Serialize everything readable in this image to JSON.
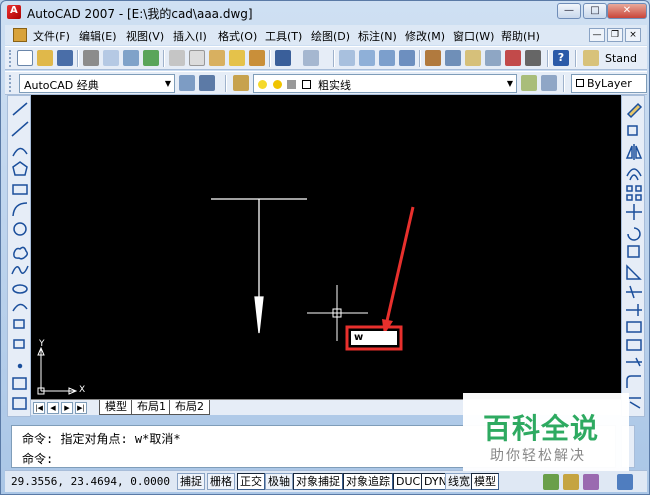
{
  "window": {
    "title": "AutoCAD 2007 - [E:\\我的cad\\aaa.dwg]",
    "minimize": "—",
    "maximize": "□",
    "close": "✕"
  },
  "menu": {
    "items": [
      "文件(F)",
      "编辑(E)",
      "视图(V)",
      "插入(I)",
      "格式(O)",
      "工具(T)",
      "绘图(D)",
      "标注(N)",
      "修改(M)",
      "窗口(W)",
      "帮助(H)"
    ],
    "mdi_min": "—",
    "mdi_restore": "❐",
    "mdi_close": "×"
  },
  "toolbar": {
    "text_style": "Stand"
  },
  "workspace": {
    "selected": "AutoCAD 经典"
  },
  "layer": {
    "current": "粗实线",
    "linetype": "ByLayer"
  },
  "canvas": {
    "cmd_popup_text": "w",
    "ucs_x": "X",
    "ucs_y": "Y",
    "annotation_color": "#e8302d"
  },
  "layout_tabs": [
    "模型",
    "布局1",
    "布局2"
  ],
  "command": {
    "history": "命令: 指定对角点: w*取消*",
    "prompt": "命令:"
  },
  "status": {
    "coordinates": "29.3556, 23.4694, 0.0000",
    "toggles": [
      "捕捉",
      "栅格",
      "正交",
      "极轴",
      "对象捕捉",
      "对象追踪",
      "DUCS",
      "DYN",
      "线宽",
      "模型"
    ]
  },
  "watermark": {
    "title": "百科全说",
    "subtitle": "助你轻松解决"
  }
}
